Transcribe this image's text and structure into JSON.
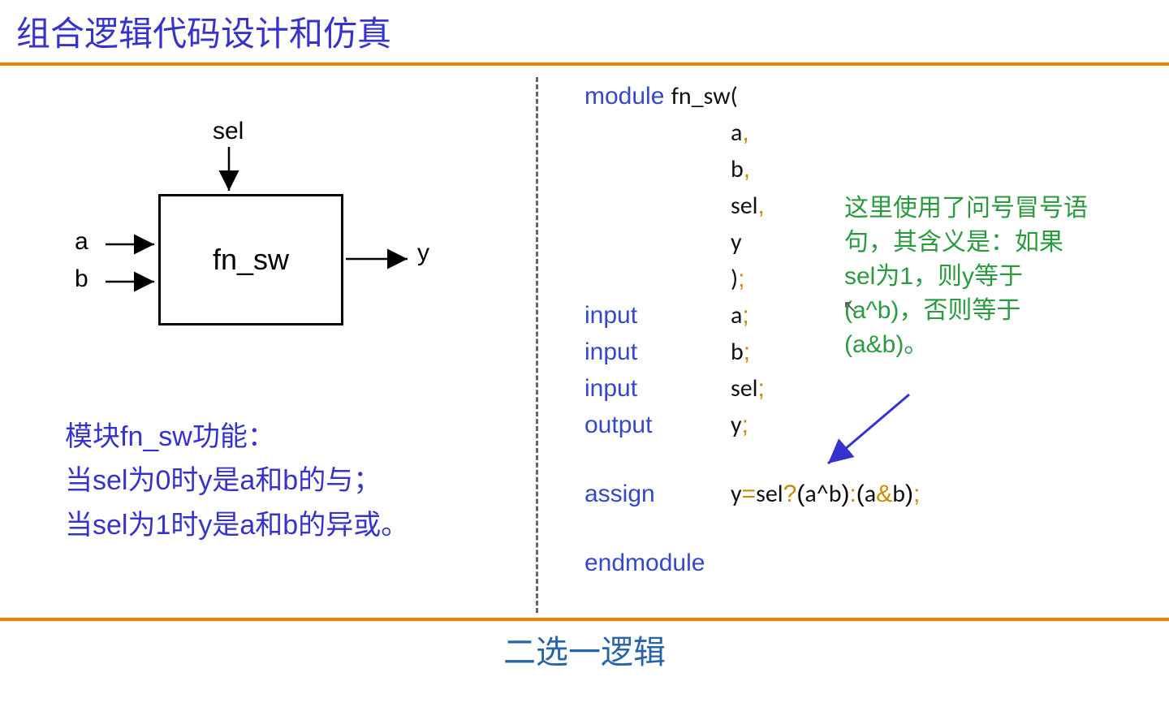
{
  "title": "组合逻辑代码设计和仿真",
  "footer": "二选一逻辑",
  "diagram": {
    "sel": "sel",
    "a": "a",
    "b": "b",
    "y": "y",
    "box_label": "fn_sw"
  },
  "description": {
    "line1": "模块fn_sw功能：",
    "line2": "当sel为0时y是a和b的与；",
    "line3": "当sel为1时y是a和b的异或。"
  },
  "code": {
    "module": "module",
    "modname": "fn_sw(",
    "p_a": "a",
    "p_b": "b",
    "p_sel": "sel",
    "p_y": "y",
    "close_paren": ")",
    "input": "input",
    "output": "output",
    "assign": "assign",
    "expr_y": "y",
    "expr_sel": "sel",
    "expr_q": "?",
    "expr_lp1": "(",
    "expr_ax": "a",
    "expr_caret": "^",
    "expr_bx": "b",
    "expr_rp1": ")",
    "expr_colon": ":",
    "expr_lp2": "(",
    "expr_aa": "a",
    "expr_amp": "&",
    "expr_ba": "b",
    "expr_rp2": ")",
    "endmodule": "endmodule",
    "comma": ",",
    "semi": ";",
    "eq": "="
  },
  "annotation": "这里使用了问号冒号语句，其含义是：如果sel为1，则y等于(a^b)，否则等于(a&b)。"
}
